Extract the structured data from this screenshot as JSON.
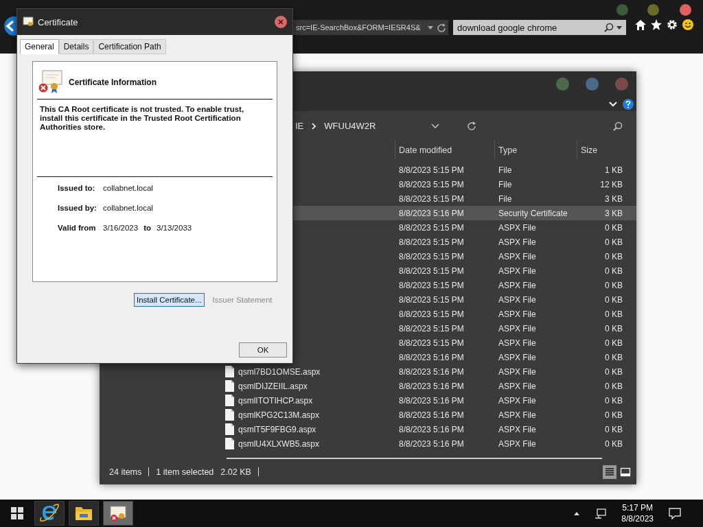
{
  "browser": {
    "address": {
      "value": "src=IE-SearchBox&FORM=IESR4S&"
    },
    "search": {
      "value": "download google chrome"
    }
  },
  "explorer": {
    "breadcrumb": [
      "IE",
      "WFUU4W2R"
    ],
    "columns": [
      "Date modified",
      "Type",
      "Size"
    ],
    "files": [
      {
        "date": "8/8/2023 5:15 PM",
        "type": "File",
        "size": "1 KB",
        "selected": false
      },
      {
        "date": "8/8/2023 5:15 PM",
        "type": "File",
        "size": "12 KB",
        "selected": false
      },
      {
        "date": "8/8/2023 5:15 PM",
        "type": "File",
        "size": "3 KB",
        "selected": false
      },
      {
        "date": "8/8/2023 5:16 PM",
        "type": "Security Certificate",
        "size": "3 KB",
        "selected": true
      },
      {
        "date": "8/8/2023 5:15 PM",
        "type": "ASPX File",
        "size": "0 KB",
        "selected": false
      },
      {
        "date": "8/8/2023 5:15 PM",
        "type": "ASPX File",
        "size": "0 KB",
        "selected": false
      },
      {
        "date": "8/8/2023 5:15 PM",
        "type": "ASPX File",
        "size": "0 KB",
        "selected": false
      },
      {
        "date": "8/8/2023 5:15 PM",
        "type": "ASPX File",
        "size": "0 KB",
        "selected": false
      },
      {
        "date": "8/8/2023 5:15 PM",
        "type": "ASPX File",
        "size": "0 KB",
        "selected": false
      },
      {
        "date": "8/8/2023 5:15 PM",
        "type": "ASPX File",
        "size": "0 KB",
        "selected": false
      },
      {
        "date": "8/8/2023 5:15 PM",
        "type": "ASPX File",
        "size": "0 KB",
        "selected": false
      },
      {
        "date": "8/8/2023 5:15 PM",
        "type": "ASPX File",
        "size": "0 KB",
        "selected": false
      },
      {
        "date": "8/8/2023 5:15 PM",
        "type": "ASPX File",
        "size": "0 KB",
        "selected": false
      },
      {
        "date": "8/8/2023 5:16 PM",
        "type": "ASPX File",
        "size": "0 KB",
        "selected": false
      },
      {
        "name": "qsml7BD1OMSE.aspx",
        "date": "8/8/2023 5:16 PM",
        "type": "ASPX File",
        "size": "0 KB",
        "selected": false
      },
      {
        "name": "qsmlDIJZEIIL.aspx",
        "date": "8/8/2023 5:16 PM",
        "type": "ASPX File",
        "size": "0 KB",
        "selected": false
      },
      {
        "name": "qsmlITOTIHCP.aspx",
        "date": "8/8/2023 5:16 PM",
        "type": "ASPX File",
        "size": "0 KB",
        "selected": false
      },
      {
        "name": "qsmlKPG2C13M.aspx",
        "date": "8/8/2023 5:16 PM",
        "type": "ASPX File",
        "size": "0 KB",
        "selected": false
      },
      {
        "name": "qsmlT5F9FBG9.aspx",
        "date": "8/8/2023 5:16 PM",
        "type": "ASPX File",
        "size": "0 KB",
        "selected": false
      },
      {
        "name": "qsmlU4XLXWB5.aspx",
        "date": "8/8/2023 5:16 PM",
        "type": "ASPX File",
        "size": "0 KB",
        "selected": false
      }
    ],
    "status": {
      "count": "24 items",
      "selection": "1 item selected",
      "size": "2.02 KB"
    },
    "views": [
      {
        "kind": "details",
        "selected": true
      },
      {
        "kind": "preview",
        "selected": false
      }
    ]
  },
  "dialog": {
    "title": "Certificate",
    "tabs": [
      {
        "label": "General",
        "selected": true
      },
      {
        "label": "Details",
        "selected": false
      },
      {
        "label": "Certification Path",
        "selected": false
      }
    ],
    "heading": "Certificate Information",
    "message": "This CA Root certificate is not trusted. To enable trust, install this certificate in the Trusted Root Certification Authorities store.",
    "fields": [
      {
        "label": "Issued to:",
        "value": "collabnet.local"
      },
      {
        "label": "Issued by:",
        "value": "collabnet.local"
      }
    ],
    "validity": {
      "label": "Valid from",
      "from": "3/16/2023",
      "separator": "to",
      "to": "3/13/2033"
    },
    "buttons": [
      {
        "label": "Install Certificate...",
        "disabled": false
      },
      {
        "label": "Issuer Statement",
        "disabled": true
      }
    ],
    "ok": "OK"
  },
  "taskbar": {
    "apps": [
      {
        "kind": "ie",
        "selected": false
      },
      {
        "kind": "folder",
        "selected": false
      },
      {
        "kind": "certificate",
        "selected": true
      }
    ],
    "time": "5:17 PM",
    "date": "8/8/2023"
  }
}
